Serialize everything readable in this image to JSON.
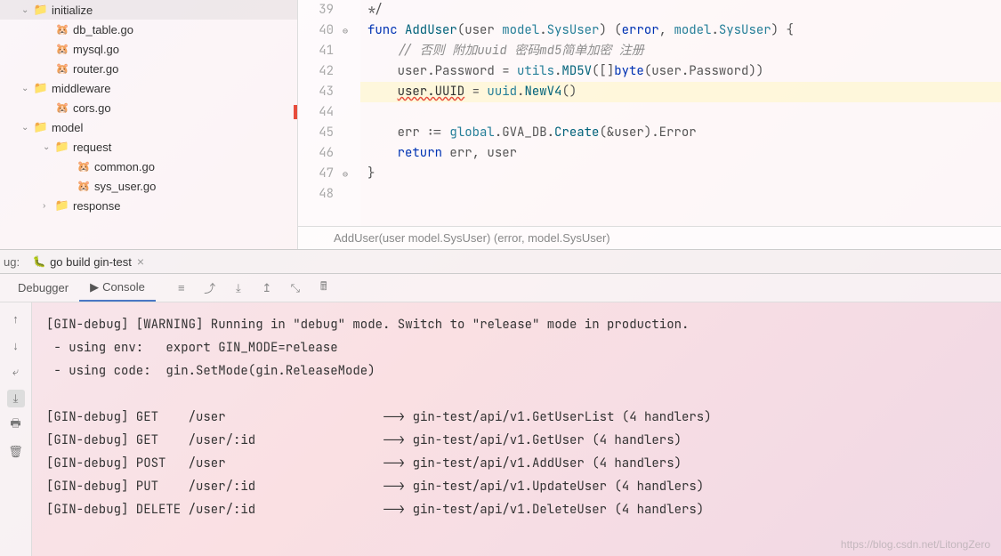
{
  "sidebar": {
    "items": [
      {
        "label": "initialize",
        "type": "folder",
        "indent": 1,
        "chevron": "down"
      },
      {
        "label": "db_table.go",
        "type": "go",
        "indent": 2
      },
      {
        "label": "mysql.go",
        "type": "go",
        "indent": 2
      },
      {
        "label": "router.go",
        "type": "go",
        "indent": 2
      },
      {
        "label": "middleware",
        "type": "folder",
        "indent": 1,
        "chevron": "down"
      },
      {
        "label": "cors.go",
        "type": "go",
        "indent": 2
      },
      {
        "label": "model",
        "type": "folder",
        "indent": 1,
        "chevron": "down"
      },
      {
        "label": "request",
        "type": "folder",
        "indent": 2,
        "chevron": "down"
      },
      {
        "label": "common.go",
        "type": "go",
        "indent": 3
      },
      {
        "label": "sys_user.go",
        "type": "go",
        "indent": 3
      },
      {
        "label": "response",
        "type": "folder",
        "indent": 2,
        "chevron": "right"
      }
    ]
  },
  "editor": {
    "lines": {
      "39": {
        "prefix": "",
        "tokens": [
          {
            "t": "op",
            "v": "*/"
          }
        ]
      },
      "40": {
        "prefix": "",
        "tokens": [
          {
            "t": "kw",
            "v": "func "
          },
          {
            "t": "fn",
            "v": "AddUser"
          },
          {
            "t": "op",
            "v": "(user "
          },
          {
            "t": "typ",
            "v": "model"
          },
          {
            "t": "op",
            "v": "."
          },
          {
            "t": "typ",
            "v": "SysUser"
          },
          {
            "t": "op",
            "v": ") ("
          },
          {
            "t": "kw",
            "v": "error"
          },
          {
            "t": "op",
            "v": ", "
          },
          {
            "t": "typ",
            "v": "model"
          },
          {
            "t": "op",
            "v": "."
          },
          {
            "t": "typ",
            "v": "SysUser"
          },
          {
            "t": "op",
            "v": ") {"
          }
        ]
      },
      "41": {
        "prefix": "    ",
        "tokens": [
          {
            "t": "com",
            "v": "// 否则 附加uuid 密码md5简单加密 注册"
          }
        ]
      },
      "42": {
        "prefix": "    ",
        "tokens": [
          {
            "t": "op",
            "v": "user.Password = "
          },
          {
            "t": "typ",
            "v": "utils"
          },
          {
            "t": "op",
            "v": "."
          },
          {
            "t": "fn",
            "v": "MD5V"
          },
          {
            "t": "op",
            "v": "([]"
          },
          {
            "t": "kw",
            "v": "byte"
          },
          {
            "t": "op",
            "v": "(user.Password))"
          }
        ]
      },
      "43": {
        "prefix": "    ",
        "tokens": [
          {
            "t": "err",
            "v": "user.UUID"
          },
          {
            "t": "op",
            "v": " = "
          },
          {
            "t": "typ",
            "v": "uuid"
          },
          {
            "t": "op",
            "v": "."
          },
          {
            "t": "fn",
            "v": "NewV4"
          },
          {
            "t": "op",
            "v": "()"
          }
        ]
      },
      "44": {
        "prefix": "",
        "tokens": []
      },
      "45": {
        "prefix": "    ",
        "tokens": [
          {
            "t": "op",
            "v": "err := "
          },
          {
            "t": "typ",
            "v": "global"
          },
          {
            "t": "op",
            "v": ".GVA_DB."
          },
          {
            "t": "fn",
            "v": "Create"
          },
          {
            "t": "op",
            "v": "(&user).Error"
          }
        ]
      },
      "46": {
        "prefix": "    ",
        "tokens": [
          {
            "t": "kw",
            "v": "return "
          },
          {
            "t": "op",
            "v": "err, user"
          }
        ]
      },
      "47": {
        "prefix": "",
        "tokens": [
          {
            "t": "op",
            "v": "}"
          }
        ]
      },
      "48": {
        "prefix": "",
        "tokens": []
      }
    },
    "line_numbers": [
      "39",
      "40",
      "41",
      "42",
      "43",
      "44",
      "45",
      "46",
      "47",
      "48"
    ],
    "fold_marks": {
      "39": "",
      "40": "⊖",
      "47": "⊖"
    },
    "current_line": "43",
    "breadcrumb": "AddUser(user model.SysUser) (error, model.SysUser)"
  },
  "debug_tab": {
    "prefix": "ug:",
    "label": "go build gin-test"
  },
  "toolbar": {
    "tabs": {
      "debugger": "Debugger",
      "console": "Console"
    }
  },
  "console": {
    "lines": [
      "[GIN-debug] [WARNING] Running in \"debug\" mode. Switch to \"release\" mode in production.",
      " - using env:   export GIN_MODE=release",
      " - using code:  gin.SetMode(gin.ReleaseMode)",
      "",
      "[GIN-debug] GET    /user                     --> gin-test/api/v1.GetUserList (4 handlers)",
      "[GIN-debug] GET    /user/:id                 --> gin-test/api/v1.GetUser (4 handlers)",
      "[GIN-debug] POST   /user                     --> gin-test/api/v1.AddUser (4 handlers)",
      "[GIN-debug] PUT    /user/:id                 --> gin-test/api/v1.UpdateUser (4 handlers)",
      "[GIN-debug] DELETE /user/:id                 --> gin-test/api/v1.DeleteUser (4 handlers)"
    ]
  },
  "watermark": "https://blog.csdn.net/LitongZero"
}
